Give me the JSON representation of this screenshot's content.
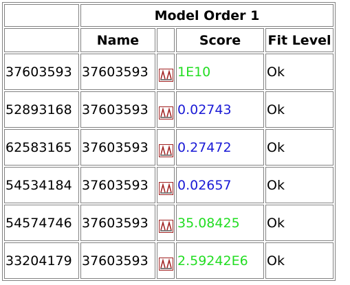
{
  "header": {
    "model_title": "Model Order 1",
    "col_name": "Name",
    "col_score": "Score",
    "col_fit": "Fit Level"
  },
  "colors": {
    "good_score": "#22dd22",
    "low_score": "#1a1ad6",
    "border": "#808080",
    "plot_icon": "#a02020"
  },
  "rows": [
    {
      "id": "37603593",
      "name": "37603593",
      "plot_icon": "plot-icon",
      "score": "1E10",
      "score_color": "green",
      "fit": "Ok"
    },
    {
      "id": "52893168",
      "name": "37603593",
      "plot_icon": "plot-icon",
      "score": "0.02743",
      "score_color": "blue",
      "fit": "Ok"
    },
    {
      "id": "62583165",
      "name": "37603593",
      "plot_icon": "plot-icon",
      "score": "0.27472",
      "score_color": "blue",
      "fit": "Ok"
    },
    {
      "id": "54534184",
      "name": "37603593",
      "plot_icon": "plot-icon",
      "score": "0.02657",
      "score_color": "blue",
      "fit": "Ok"
    },
    {
      "id": "54574746",
      "name": "37603593",
      "plot_icon": "plot-icon",
      "score": "35.08425",
      "score_color": "green",
      "fit": "Ok"
    },
    {
      "id": "33204179",
      "name": "37603593",
      "plot_icon": "plot-icon",
      "score": "2.59242E6",
      "score_color": "green",
      "fit": "Ok"
    }
  ]
}
